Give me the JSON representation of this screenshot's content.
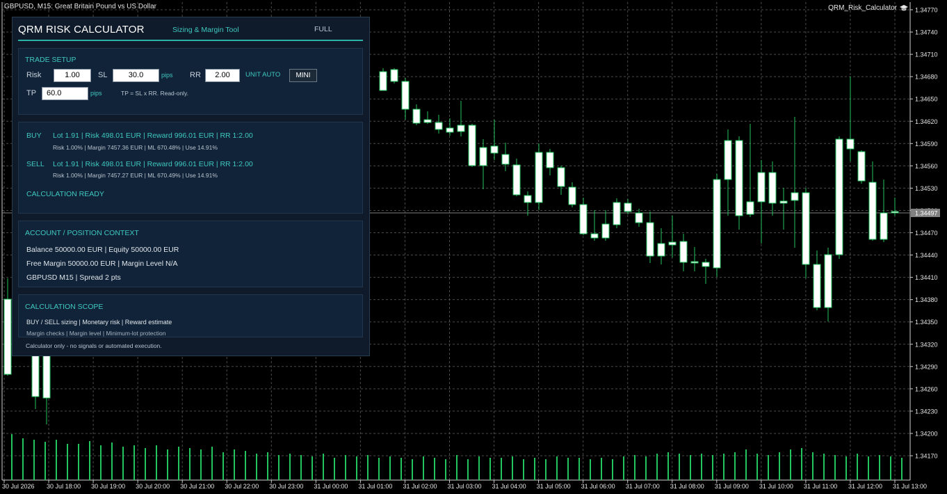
{
  "chart": {
    "title": "GBPUSD, M15:  Great Britain Pound vs US Dollar",
    "ea_name": "QRM_Risk_Calculator",
    "current_price": "1.34497",
    "price_labels": [
      "1.34770",
      "1.34740",
      "1.34710",
      "1.34680",
      "1.34650",
      "1.34620",
      "1.34590",
      "1.34560",
      "1.34530",
      "1.34500",
      "1.34470",
      "1.34440",
      "1.34410",
      "1.34380",
      "1.34350",
      "1.34320",
      "1.34290",
      "1.34260",
      "1.34230",
      "1.34200",
      "1.34170"
    ],
    "time_labels": [
      "30 Jul 2026",
      "30 Jul 18:00",
      "30 Jul 19:00",
      "30 Jul 20:00",
      "30 Jul 21:00",
      "30 Jul 22:00",
      "30 Jul 23:00",
      "31 Jul 00:00",
      "31 Jul 01:00",
      "31 Jul 02:00",
      "31 Jul 03:00",
      "31 Jul 04:00",
      "31 Jul 05:00",
      "31 Jul 06:00",
      "31 Jul 07:00",
      "31 Jul 08:00",
      "31 Jul 09:00",
      "31 Jul 10:00",
      "31 Jul 11:00",
      "31 Jul 12:00",
      "31 Jul 13:00"
    ],
    "colors": {
      "background": "#000000",
      "grid": "#4a4a4a",
      "bull_wick": "#22c55e",
      "candle_body": "#ffffff",
      "volume": "#22c55e",
      "axis_text": "#e6e6e6",
      "price_line": "#808080"
    }
  },
  "panel": {
    "title": "QRM RISK CALCULATOR",
    "subtitle": "Sizing & Margin Tool",
    "full_label": "FULL",
    "trade_setup": {
      "title": "TRADE SETUP",
      "risk_label": "Risk",
      "risk_value": "1.00",
      "sl_label": "SL",
      "sl_value": "30.0",
      "sl_unit": "pips",
      "rr_label": "RR",
      "rr_value": "2.00",
      "unit_mode": "UNIT AUTO",
      "mini_label": "MINI",
      "tp_label": "TP",
      "tp_value": "60.0",
      "tp_unit": "pips",
      "tp_hint": "TP = SL x RR. Read-only."
    },
    "results": {
      "buy_label": "BUY",
      "buy_main": "Lot 1.91 | Risk 498.01 EUR | Reward 996.01 EUR | RR 1:2.00",
      "buy_sub": "Risk 1.00% | Margin 7457.36 EUR | ML 670.48% | Use 14.91%",
      "sell_label": "SELL",
      "sell_main": "Lot 1.91 | Risk 498.01 EUR | Reward 996.01 EUR | RR 1:2.00",
      "sell_sub": "Risk 1.00% | Margin 7457.27 EUR | ML 670.49% | Use 14.91%",
      "status": "CALCULATION READY"
    },
    "account": {
      "title": "ACCOUNT / POSITION CONTEXT",
      "line1": "Balance 50000.00 EUR | Equity 50000.00 EUR",
      "line2": "Free Margin 50000.00 EUR | Margin Level N/A",
      "line3": "GBPUSD M15 | Spread 2 pts"
    },
    "scope": {
      "title": "CALCULATION SCOPE",
      "line1": "BUY / SELL sizing  |  Monetary risk  |  Reward estimate",
      "line2": "Margin checks  |  Margin level  |  Minimum-lot protection"
    },
    "footer": "Calculator only - no signals or automated execution."
  }
}
